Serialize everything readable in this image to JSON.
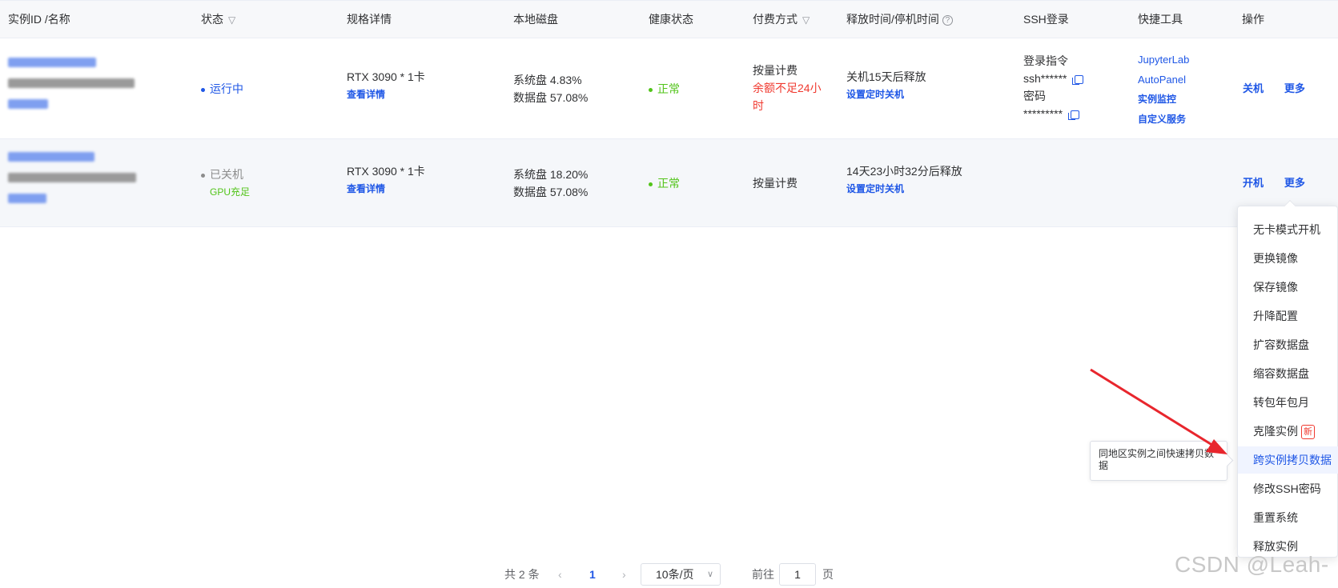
{
  "columns": {
    "id": "实例ID /名称",
    "status": "状态",
    "spec": "规格详情",
    "disk": "本地磁盘",
    "health": "健康状态",
    "payment": "付费方式",
    "release": "释放时间/停机时间",
    "ssh": "SSH登录",
    "tools": "快捷工具",
    "ops": "操作"
  },
  "rows": [
    {
      "status": "运行中",
      "status_sub": "",
      "spec": "RTX 3090 * 1卡",
      "spec_link": "查看详情",
      "disk_sys": "系统盘 4.83%",
      "disk_data": "数据盘 57.08%",
      "health": "正常",
      "payment": "按量计费",
      "payment_warn_1": "余额不足24小",
      "payment_warn_2": "时",
      "release": "关机15天后释放",
      "release_link": "设置定时关机",
      "ssh_cmd_label": "登录指令",
      "ssh_cmd_value": "ssh******",
      "ssh_pwd_label": "密码",
      "ssh_pwd_value": "*********",
      "tools": [
        "JupyterLab",
        "AutoPanel",
        "实例监控",
        "自定义服务"
      ],
      "op_primary": "关机",
      "op_more": "更多"
    },
    {
      "status": "已关机",
      "status_sub": "GPU充足",
      "spec": "RTX 3090 * 1卡",
      "spec_link": "查看详情",
      "disk_sys": "系统盘 18.20%",
      "disk_data": "数据盘 57.08%",
      "health": "正常",
      "payment": "按量计费",
      "release": "14天23小时32分后释放",
      "release_link": "设置定时关机",
      "op_primary": "开机",
      "op_more": "更多"
    }
  ],
  "dropdown": {
    "items": [
      "无卡模式开机",
      "更换镜像",
      "保存镜像",
      "升降配置",
      "扩容数据盘",
      "缩容数据盘",
      "转包年包月",
      "克隆实例",
      "跨实例拷贝数据",
      "修改SSH密码",
      "重置系统",
      "释放实例"
    ],
    "new_badge": "新",
    "active_index": 8
  },
  "tooltip": "同地区实例之间快速拷贝数据",
  "pagination": {
    "total": "共 2 条",
    "current_page": "1",
    "page_size": "10条/页",
    "goto_label": "前往",
    "goto_value": "1",
    "page_suffix": "页"
  },
  "icons": {
    "filter": "filter-icon",
    "help": "help-icon",
    "copy": "copy-icon",
    "prev": "chevron-left-icon",
    "next": "chevron-right-icon",
    "select": "chevron-down-icon"
  },
  "colors": {
    "accent": "#1f57e6",
    "running": "#1f57e6",
    "healthy": "#52c41a",
    "warning": "#f0392f",
    "stopped": "#8c8c8c",
    "annotation_arrow": "#e8262d"
  },
  "watermark": "CSDN @Leah-"
}
